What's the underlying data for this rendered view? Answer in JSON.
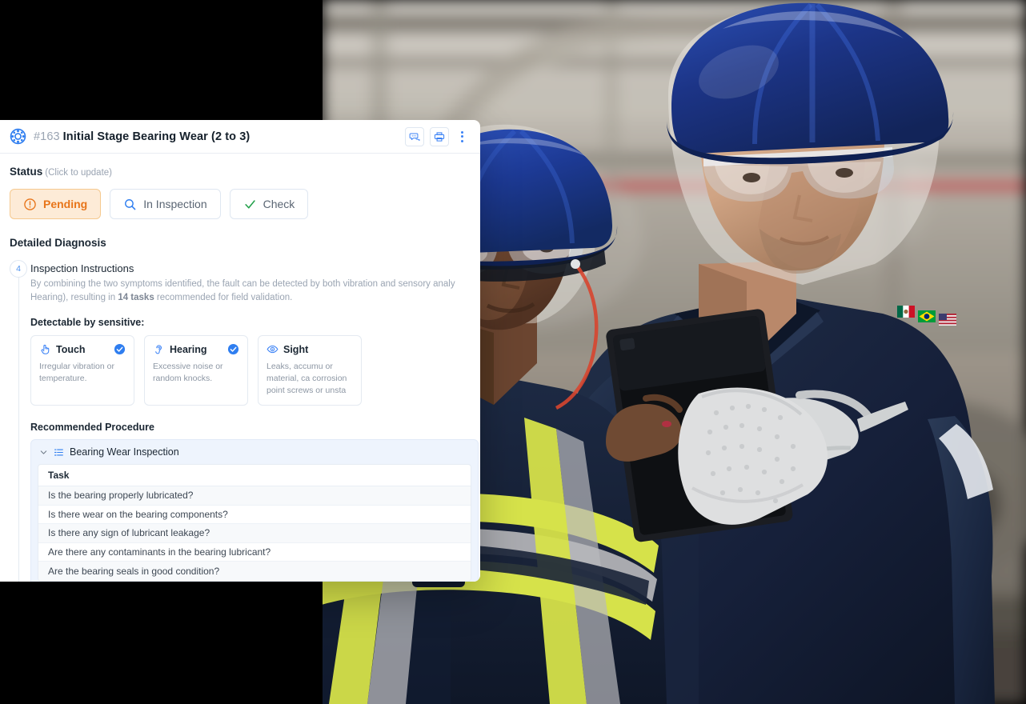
{
  "header": {
    "logo_icon": "bearing-icon",
    "id": "#163",
    "title": "Initial Stage Bearing Wear (2 to 3)",
    "actions": [
      {
        "name": "comments-button",
        "icon": "chat-bubble-icon"
      },
      {
        "name": "print-button",
        "icon": "printer-icon"
      },
      {
        "name": "more-options-button",
        "icon": "vertical-dots-icon"
      }
    ]
  },
  "status": {
    "label": "Status",
    "hint": "(Click to update)",
    "options": [
      {
        "label": "Pending",
        "icon": "alert-circle-icon",
        "selected": true
      },
      {
        "label": "In Inspection",
        "icon": "magnifier-icon",
        "selected": false
      },
      {
        "label": "Check",
        "icon": "check-icon",
        "selected": false
      }
    ]
  },
  "diagnosis": {
    "section_title": "Detailed Diagnosis",
    "step_number": "4",
    "step_title": "Inspection Instructions",
    "step_description_part1": "By combining the two symptoms identified, the fault can be detected by both vibration and sensory analy",
    "step_description_part2": "Hearing), resulting in ",
    "step_description_bold": "14 tasks",
    "step_description_part3": " recommended for field validation.",
    "sensitive_label": "Detectable by sensitive:",
    "senses": [
      {
        "name": "Touch",
        "icon": "hand-touch-icon",
        "checked": true,
        "description": "Irregular vibration or temperature."
      },
      {
        "name": "Hearing",
        "icon": "ear-icon",
        "checked": true,
        "description": "Excessive noise or random knocks."
      },
      {
        "name": "Sight",
        "icon": "eye-icon",
        "checked": false,
        "description": "Leaks, accumu or material, ca corrosion point screws or unsta"
      }
    ]
  },
  "procedure": {
    "title": "Recommended Procedure",
    "group_label": "Bearing Wear Inspection",
    "group_icon": "checklist-icon",
    "collapse_icon": "chevron-down-icon",
    "column_header": "Task",
    "tasks": [
      "Is the bearing properly lubricated?",
      "Is there wear on the bearing components?",
      "Is there any sign of lubricant leakage?",
      "Are there any contaminants in the bearing lubricant?",
      "Are the bearing seals in good condition?"
    ]
  },
  "colors": {
    "accent_blue": "#3b82f6",
    "pending_orange": "#e8751a",
    "pending_bg": "#fdebd7",
    "check_green": "#22a04a",
    "panel_blue": "#eef4fd"
  }
}
